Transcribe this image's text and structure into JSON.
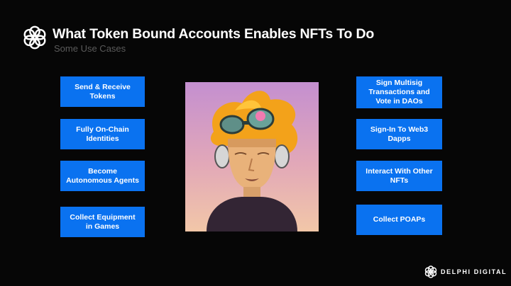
{
  "header": {
    "title": "What Token Bound Accounts Enables NFTs To Do",
    "subtitle": "Some Use Cases"
  },
  "left_cards": [
    {
      "label": "Send & Receive Tokens"
    },
    {
      "label": "Fully On-Chain Identities"
    },
    {
      "label": "Become Autonomous Agents"
    },
    {
      "label": "Collect Equipment in Games"
    }
  ],
  "right_cards": [
    {
      "label": "Sign Multisig Transactions and Vote in DAOs"
    },
    {
      "label": "Sign-In To Web3 Dapps"
    },
    {
      "label": "Interact With Other NFTs"
    },
    {
      "label": "Collect POAPs"
    }
  ],
  "brand": {
    "name": "DELPHI DIGITAL"
  },
  "colors": {
    "background": "#060606",
    "card": "#0a72f0",
    "subtitle": "#5b5b5b"
  },
  "icons": {
    "logo": "delphi-logo-icon",
    "art": "nft-character-illustration"
  }
}
